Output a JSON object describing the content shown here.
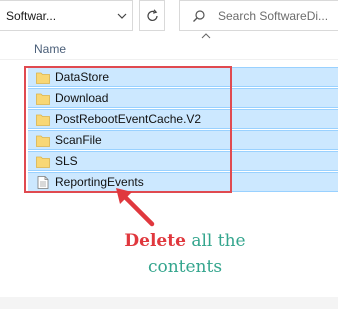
{
  "address_bar": {
    "path": "Softwar...",
    "chevron_icon": "chevron-down-icon"
  },
  "refresh": {
    "icon": "refresh-icon"
  },
  "search": {
    "placeholder": "Search SoftwareDi...",
    "icon": "search-icon"
  },
  "columns": {
    "name_header": "Name"
  },
  "files": [
    {
      "name": "DataStore",
      "type": "folder",
      "selected": true
    },
    {
      "name": "Download",
      "type": "folder",
      "selected": true
    },
    {
      "name": "PostRebootEventCache.V2",
      "type": "folder",
      "selected": true
    },
    {
      "name": "ScanFile",
      "type": "folder",
      "selected": true
    },
    {
      "name": "SLS",
      "type": "folder",
      "selected": true
    },
    {
      "name": "ReportingEvents",
      "type": "file",
      "selected": true
    }
  ],
  "annotation": {
    "highlight": "Delete",
    "rest_line1": "all the",
    "line2": "contents"
  },
  "colors": {
    "selection_fill": "#cce8ff",
    "selection_border": "#99d1ff",
    "annotation_red": "#e0383e",
    "annotation_green": "#33a58d",
    "folder_yellow": "#f8d775"
  }
}
